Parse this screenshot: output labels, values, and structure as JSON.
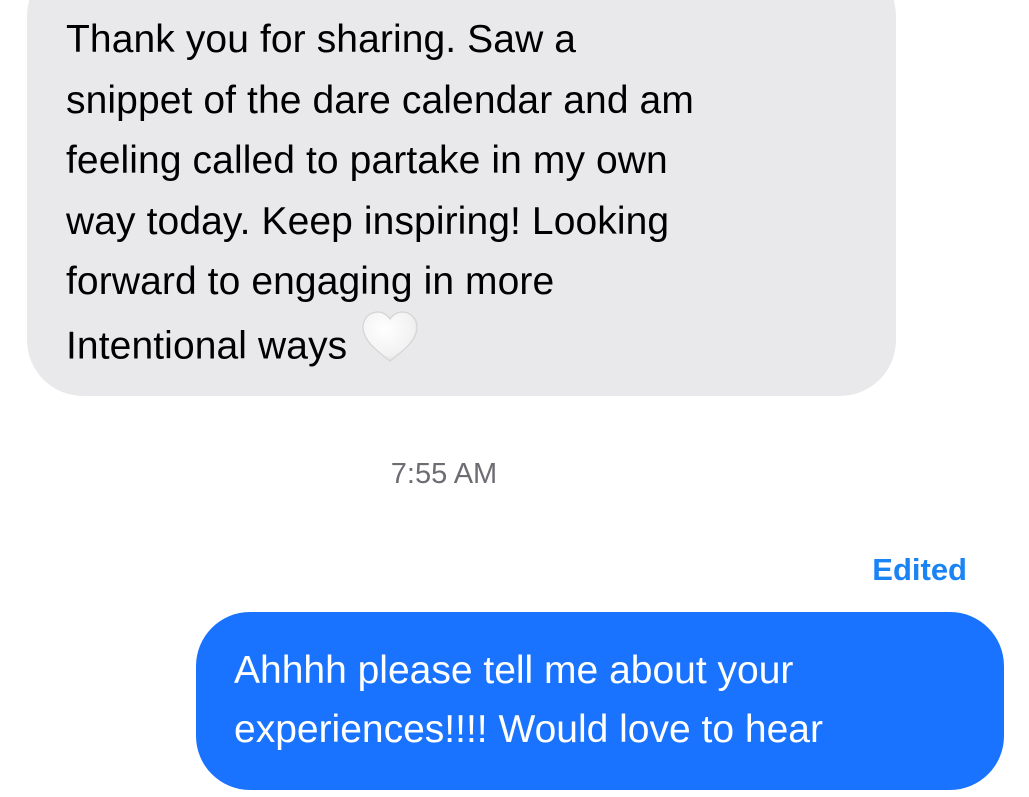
{
  "incoming_message": {
    "lines": [
      "Thank you for sharing. Saw a",
      "snippet of the dare calendar and am",
      "feeling called to partake in my own",
      "way today. Keep inspiring! Looking",
      "forward to engaging in more",
      "Intentional ways"
    ],
    "emoji": "white-heart-icon",
    "bubble_color": "#e9e9eb"
  },
  "timestamp": "7:55 AM",
  "edited_label": "Edited",
  "outgoing_message": {
    "lines": [
      "Ahhhh please tell me about your",
      "experiences!!!! Would love to hear"
    ],
    "bubble_color": "#1a73ff"
  },
  "colors": {
    "accent": "#1a84f5",
    "outgoing_text": "#ffffff",
    "incoming_text": "#000000"
  }
}
